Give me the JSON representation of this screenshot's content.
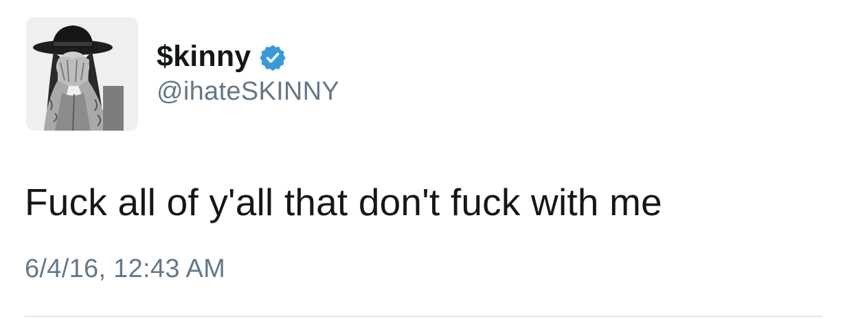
{
  "tweet": {
    "user": {
      "display_name": "$kinny",
      "handle": "@ihateSKINNY",
      "verified": true,
      "avatar_icon": "profile-photo"
    },
    "text": "Fuck all of y'all that don't fuck with me",
    "timestamp": "6/4/16, 12:43 AM"
  },
  "colors": {
    "text_primary": "#14171a",
    "text_secondary": "#657786",
    "verified_blue": "#3a9ad9",
    "divider": "#e1e8ed"
  }
}
